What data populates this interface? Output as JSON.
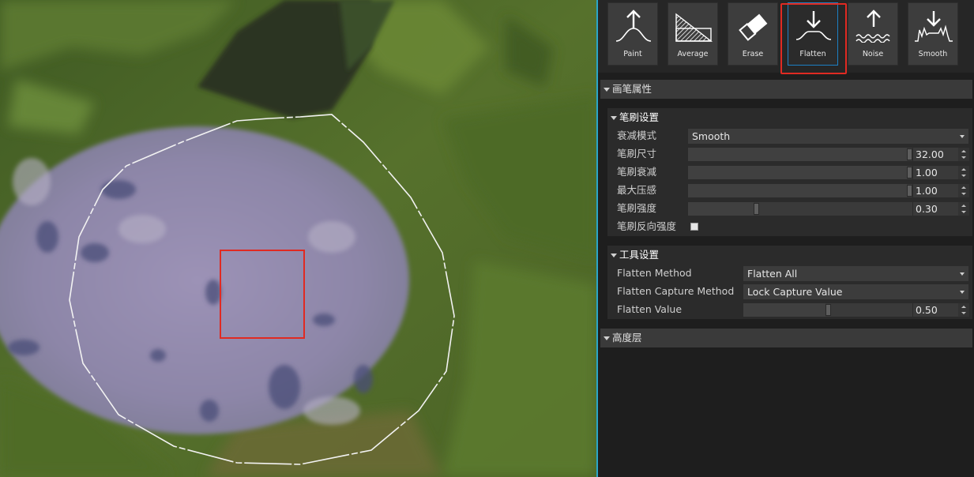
{
  "toolbar": {
    "tools": [
      {
        "label": "Paint",
        "icon": "paint-raise-icon"
      },
      {
        "label": "Average",
        "icon": "average-icon"
      },
      {
        "label": "Erase",
        "icon": "eraser-icon"
      },
      {
        "label": "Flatten",
        "icon": "flatten-icon",
        "active": true
      },
      {
        "label": "Noise",
        "icon": "noise-icon"
      },
      {
        "label": "Smooth",
        "icon": "smooth-icon"
      }
    ]
  },
  "brush_properties": {
    "title": "画笔属性",
    "brush_settings": {
      "title": "笔刷设置",
      "falloff_mode": {
        "label": "衰减模式",
        "value": "Smooth"
      },
      "brush_size": {
        "label": "笔刷尺寸",
        "value": "32.00",
        "level": 1.0
      },
      "brush_falloff": {
        "label": "笔刷衰减",
        "value": "1.00",
        "level": 1.0
      },
      "max_pressure": {
        "label": "最大压感",
        "value": "1.00",
        "level": 1.0
      },
      "brush_strength": {
        "label": "笔刷强度",
        "value": "0.30",
        "level": 0.3
      },
      "reverse_strength": {
        "label": "笔刷反向强度",
        "checked": false
      }
    },
    "tool_settings": {
      "title": "工具设置",
      "flatten_method": {
        "label": "Flatten Method",
        "value": "Flatten All"
      },
      "flatten_capture_method": {
        "label": "Flatten Capture Method",
        "value": "Lock Capture Value"
      },
      "flatten_value": {
        "label": "Flatten Value",
        "value": "0.50",
        "level": 0.5
      }
    }
  },
  "height_layers": {
    "title": "高度层"
  },
  "colors": {
    "accent_blue": "#1d7fc4",
    "highlight_red": "#e02a22",
    "viewport_divider": "#2aa6c9"
  }
}
